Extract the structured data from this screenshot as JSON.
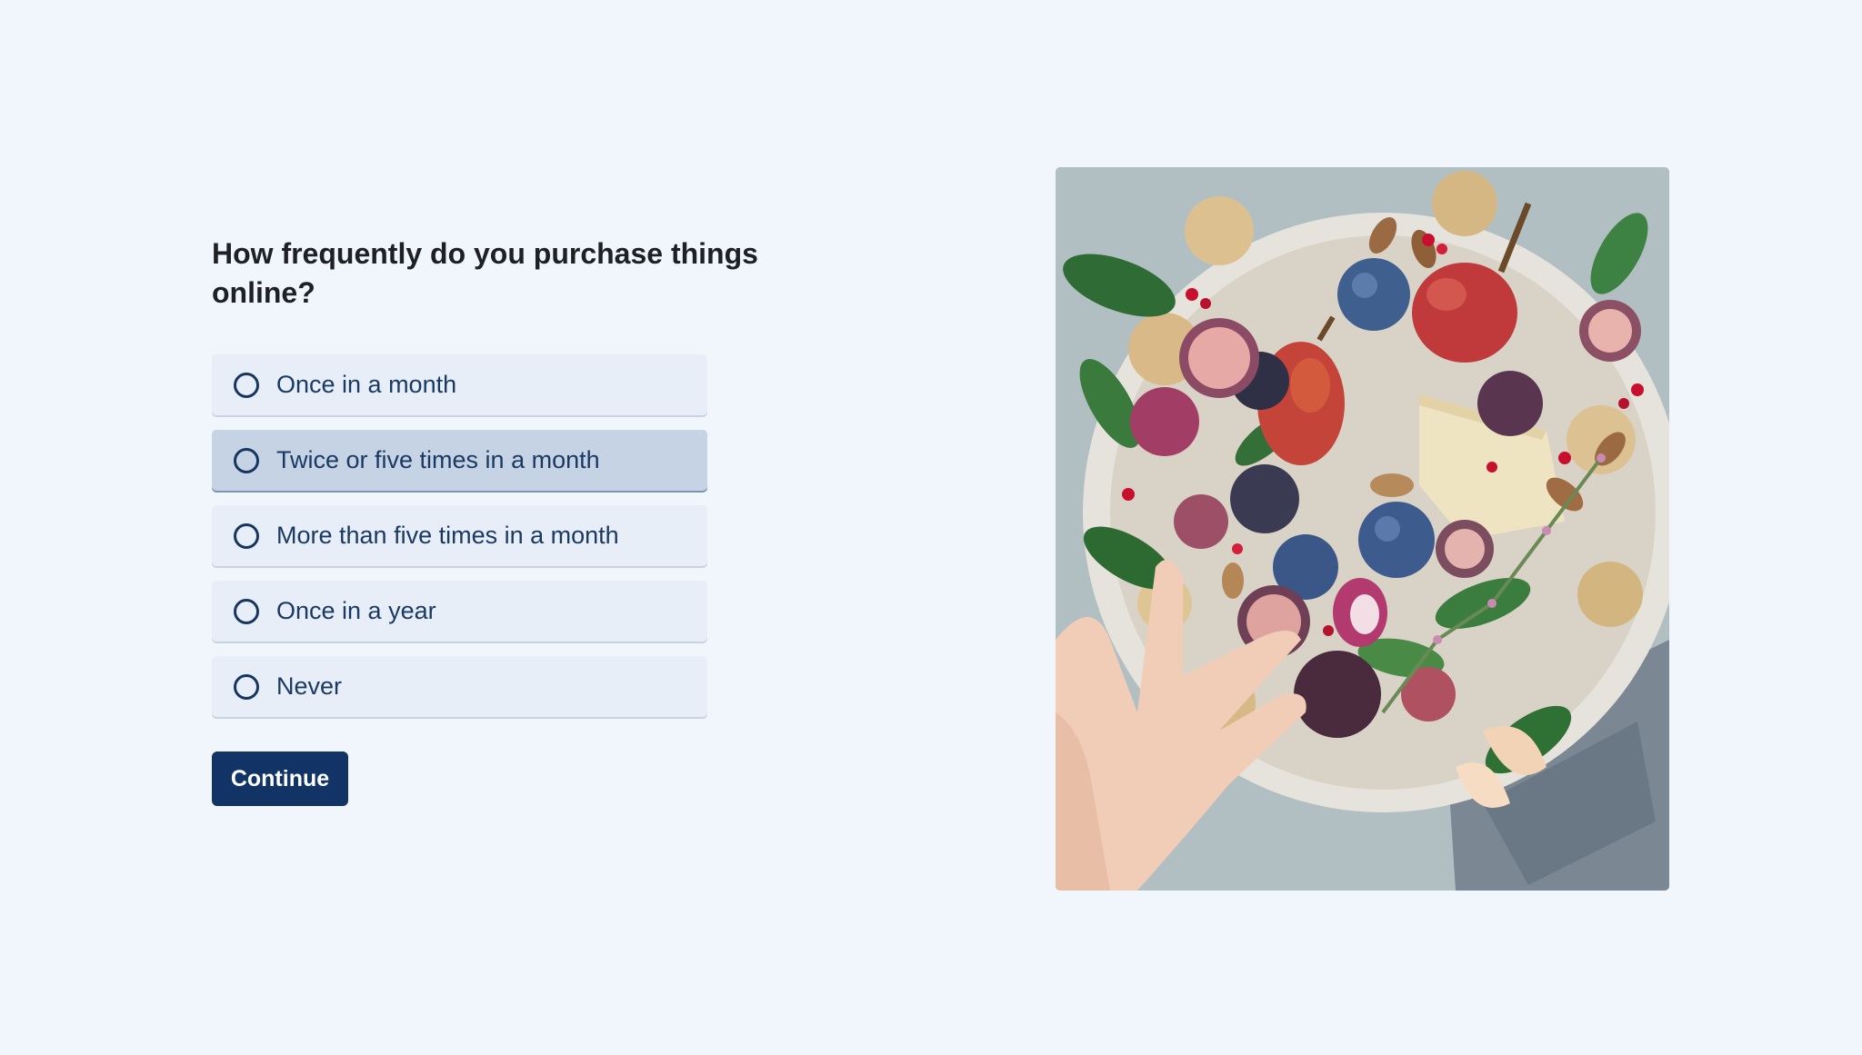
{
  "survey": {
    "question": "How frequently do you purchase things online?",
    "options": [
      {
        "label": "Once in a month",
        "state": "default"
      },
      {
        "label": "Twice or five times in a month",
        "state": "hovered"
      },
      {
        "label": "More than five times in a month",
        "state": "default"
      },
      {
        "label": "Once in a year",
        "state": "default"
      },
      {
        "label": "Never",
        "state": "default"
      }
    ],
    "continue_label": "Continue"
  },
  "image": {
    "subject": "platter of figs, pears, plums, cheese, crackers and nuts with a hand reaching in"
  },
  "colors": {
    "background": "#f1f6fd",
    "option_bg": "#e7eef8",
    "option_hover_bg": "#c6d3e4",
    "accent": "#123365",
    "text": "#1a3a63"
  }
}
